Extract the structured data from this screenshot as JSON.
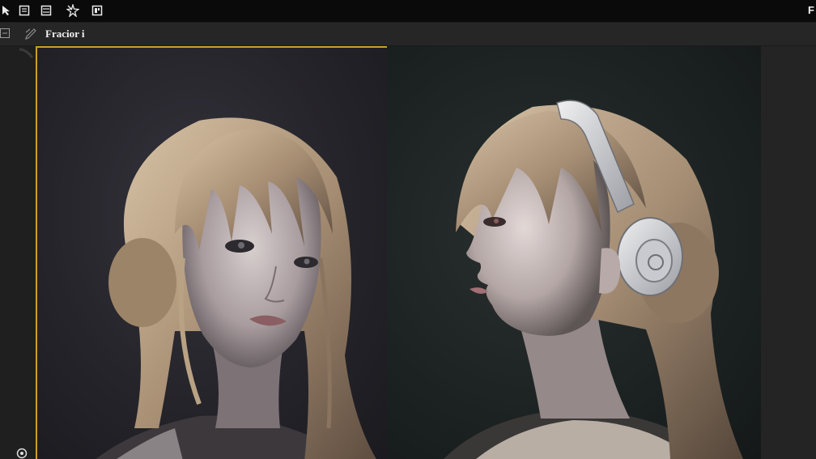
{
  "menubar": {
    "icons": [
      "pointer-icon",
      "panel-icon",
      "menu-icon",
      "star-tool-icon",
      "image-box-icon"
    ],
    "right_label": "F"
  },
  "toolbar": {
    "title": "Fracior i",
    "icons": [
      "frame-icon",
      "pen-icon"
    ]
  },
  "canvas": {
    "panels": [
      {
        "name": "portrait-front",
        "description_icon": "portrait-image"
      },
      {
        "name": "portrait-profile-headphones",
        "description_icon": "portrait-image"
      }
    ]
  },
  "colors": {
    "accent": "#c9a227",
    "menubar_bg": "#0a0a0a",
    "toolbar_bg": "#262626"
  }
}
